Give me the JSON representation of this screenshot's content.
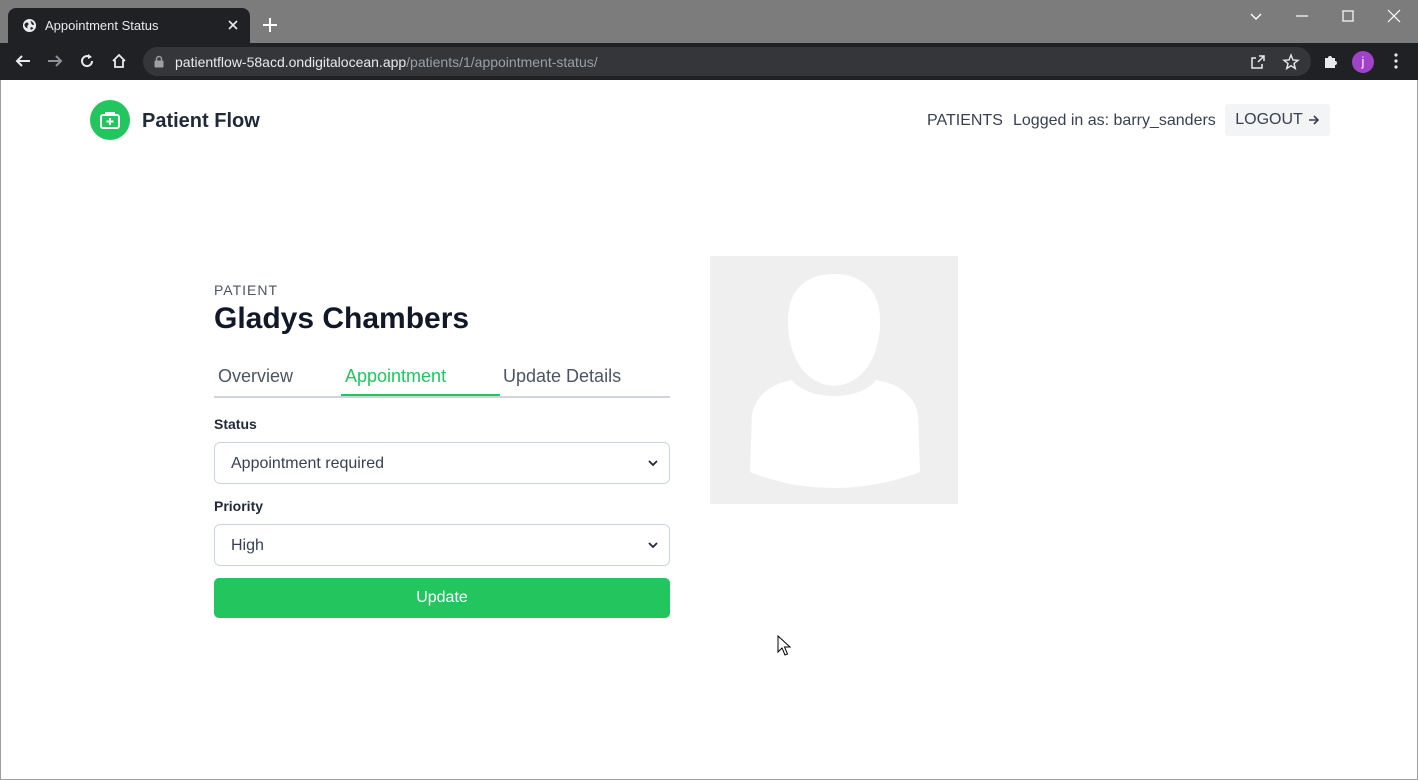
{
  "browser": {
    "tab_title": "Appointment Status",
    "url_host": "patientflow-58acd.ondigitalocean.app",
    "url_path": "/patients/1/appointment-status/",
    "profile_initial": "j"
  },
  "header": {
    "brand": "Patient Flow",
    "nav_patients": "PATIENTS",
    "logged_in": "Logged in as: barry_sanders",
    "logout": "LOGOUT"
  },
  "patient": {
    "kicker": "PATIENT",
    "name": "Gladys Chambers"
  },
  "tabs": [
    {
      "label": "Overview"
    },
    {
      "label": "Appointment"
    },
    {
      "label": "Update Details"
    }
  ],
  "form": {
    "status_label": "Status",
    "status_value": "Appointment required",
    "priority_label": "Priority",
    "priority_value": "High",
    "submit_label": "Update"
  },
  "colors": {
    "accent": "#22c55e",
    "chrome_dark": "#202124",
    "titlebar": "#7c7c7c",
    "placeholder_bg": "#efefef",
    "placeholder_fg": "#ffffff"
  },
  "icons": {
    "brand": "medical-kit-icon",
    "photo": "person-silhouette-icon",
    "logout": "arrow-right-icon"
  }
}
